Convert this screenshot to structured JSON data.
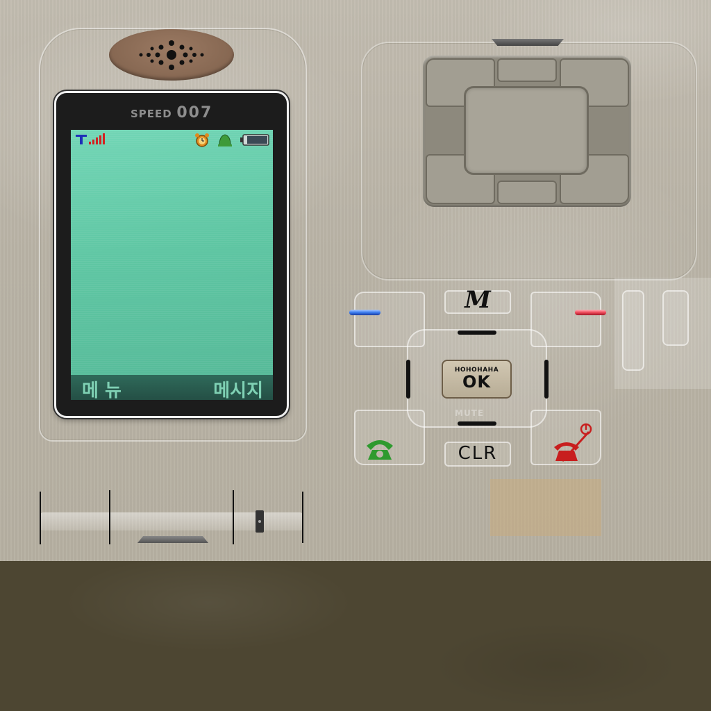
{
  "phone": {
    "brand": {
      "prefix": "SPEED",
      "model": "007"
    },
    "status_bar": {
      "carrier_icon": "T-carrier-icon",
      "signal_icon": "signal-bars-icon",
      "alarm_icon": "alarm-clock-icon",
      "bell_icon": "bell-icon",
      "battery_icon": "battery-icon"
    },
    "softkeys": {
      "left": "메 뉴",
      "right": "메시지"
    },
    "keys": {
      "menu": "M",
      "ok_small": "HOHOHAHA",
      "ok": "OK",
      "clear": "CLR",
      "mute_ghost": "MUTE",
      "call_icon": "green-phone-icon",
      "end_icon": "red-phone-power-icon"
    },
    "colors": {
      "screen": "#5fc6a3",
      "softkey_text": "#7fd1b4",
      "led_blue": "#3a7cf0",
      "led_red": "#f04a5a",
      "call_green": "#2f9a2f",
      "end_red": "#c81e1e"
    }
  }
}
